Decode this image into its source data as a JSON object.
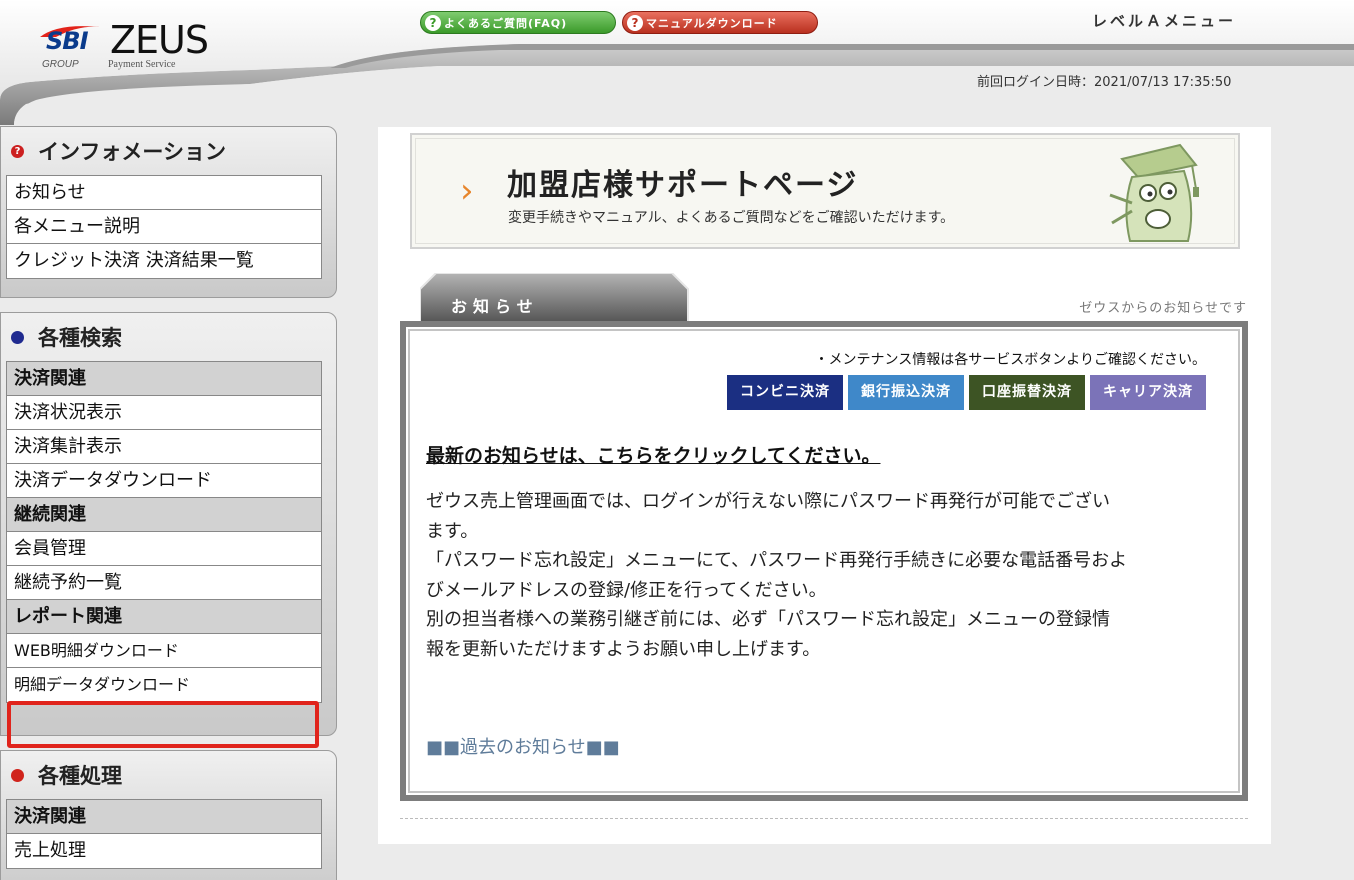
{
  "header": {
    "logo": {
      "sbi": "SBI",
      "zeus": "ZEUS",
      "group": "GROUP",
      "payment_service": "Payment Service"
    },
    "faq_button": "よくあるご質問(FAQ)",
    "manual_button": "マニュアルダウンロード",
    "level_menu": "レベルＡメニュー",
    "last_login": "前回ログイン日時：2021/07/13 17:35:50"
  },
  "sidebar": {
    "information": {
      "title": "インフォメーション",
      "items": [
        "お知らせ",
        "各メニュー説明",
        "クレジット決済 決済結果一覧"
      ]
    },
    "search": {
      "title": "各種検索",
      "items": [
        {
          "label": "決済関連",
          "category": true
        },
        {
          "label": "決済状況表示",
          "category": false
        },
        {
          "label": "決済集計表示",
          "category": false
        },
        {
          "label": "決済データダウンロード",
          "category": false
        },
        {
          "label": "継続関連",
          "category": true
        },
        {
          "label": "会員管理",
          "category": false
        },
        {
          "label": "継続予約一覧",
          "category": false
        },
        {
          "label": "レポート関連",
          "category": true
        },
        {
          "label": "WEB明細ダウンロード",
          "category": false
        },
        {
          "label": "明細データダウンロード",
          "category": false
        }
      ]
    },
    "processing": {
      "title": "各種処理",
      "items": [
        {
          "label": "決済関連",
          "category": true
        },
        {
          "label": "売上処理",
          "category": false
        }
      ]
    }
  },
  "main": {
    "support": {
      "title": "加盟店様サポートページ",
      "description": "変更手続きやマニュアル、よくあるご質問などをご確認いただけます。"
    },
    "notice": {
      "tab_label": "お知らせ",
      "subtitle": "ゼウスからのお知らせです",
      "maintenance_note": "・メンテナンス情報は各サービスボタンよりご確認ください。",
      "services": [
        "コンビニ決済",
        "銀行振込決済",
        "口座振替決済",
        "キャリア決済"
      ],
      "latest_link": "最新のお知らせは、こちらをクリックしてください。",
      "body_lines": [
        "ゼウス売上管理画面では、ログインが行えない際にパスワード再発行が可能でござい",
        "ます。",
        "「パスワード忘れ設定」メニューにて、パスワード再発行手続きに必要な電話番号およ",
        "びメールアドレスの登録/修正を行ってください。",
        "別の担当者様への業務引継ぎ前には、必ず「パスワード忘れ設定」メニューの登録情",
        "報を更新いただけますようお願い申し上げます。"
      ],
      "past_link": "■■過去のお知らせ■■"
    }
  },
  "colors": {
    "faq": "#3b9a2a",
    "manual": "#b9301f",
    "convenience": "#1b2f82",
    "bank": "#3f88c9",
    "account": "#3d5424",
    "carrier": "#7b73b8",
    "highlight": "#e0241c"
  }
}
